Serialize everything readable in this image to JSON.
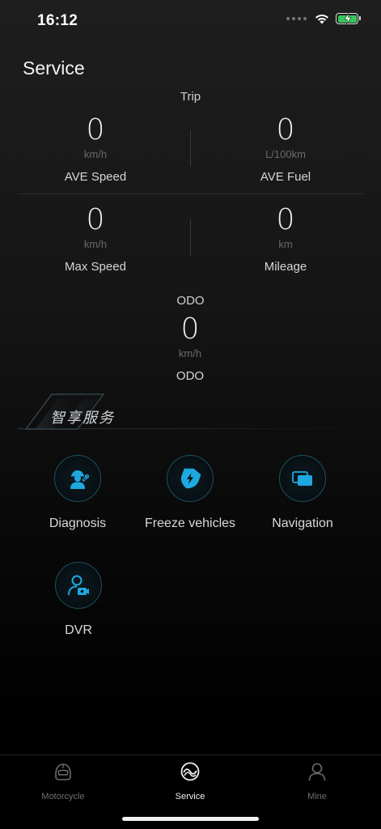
{
  "status_bar": {
    "time": "16:12"
  },
  "header": {
    "title": "Service"
  },
  "trip": {
    "title": "Trip",
    "stats": [
      {
        "value": "0",
        "unit": "km/h",
        "label": "AVE Speed"
      },
      {
        "value": "0",
        "unit": "L/100km",
        "label": "AVE Fuel"
      },
      {
        "value": "0",
        "unit": "km/h",
        "label": "Max Speed"
      },
      {
        "value": "0",
        "unit": "km",
        "label": "Mileage"
      }
    ]
  },
  "odo": {
    "title": "ODO",
    "value": "0",
    "unit": "km/h",
    "label": "ODO"
  },
  "smart_services": {
    "title": "智享服务",
    "items": [
      {
        "label": "Diagnosis",
        "icon": "mechanic-icon"
      },
      {
        "label": "Freeze vehicles",
        "icon": "lightning-shield-icon"
      },
      {
        "label": "Navigation",
        "icon": "screens-icon"
      },
      {
        "label": "DVR",
        "icon": "user-camera-icon"
      }
    ]
  },
  "tab_bar": {
    "active": "Service",
    "tabs": [
      {
        "label": "Motorcycle",
        "icon": "helmet-icon"
      },
      {
        "label": "Service",
        "icon": "service-wave-icon"
      },
      {
        "label": "Mine",
        "icon": "person-icon"
      }
    ]
  },
  "colors": {
    "accent": "#1fa8e0",
    "battery": "#34c759",
    "background": "#000000"
  }
}
